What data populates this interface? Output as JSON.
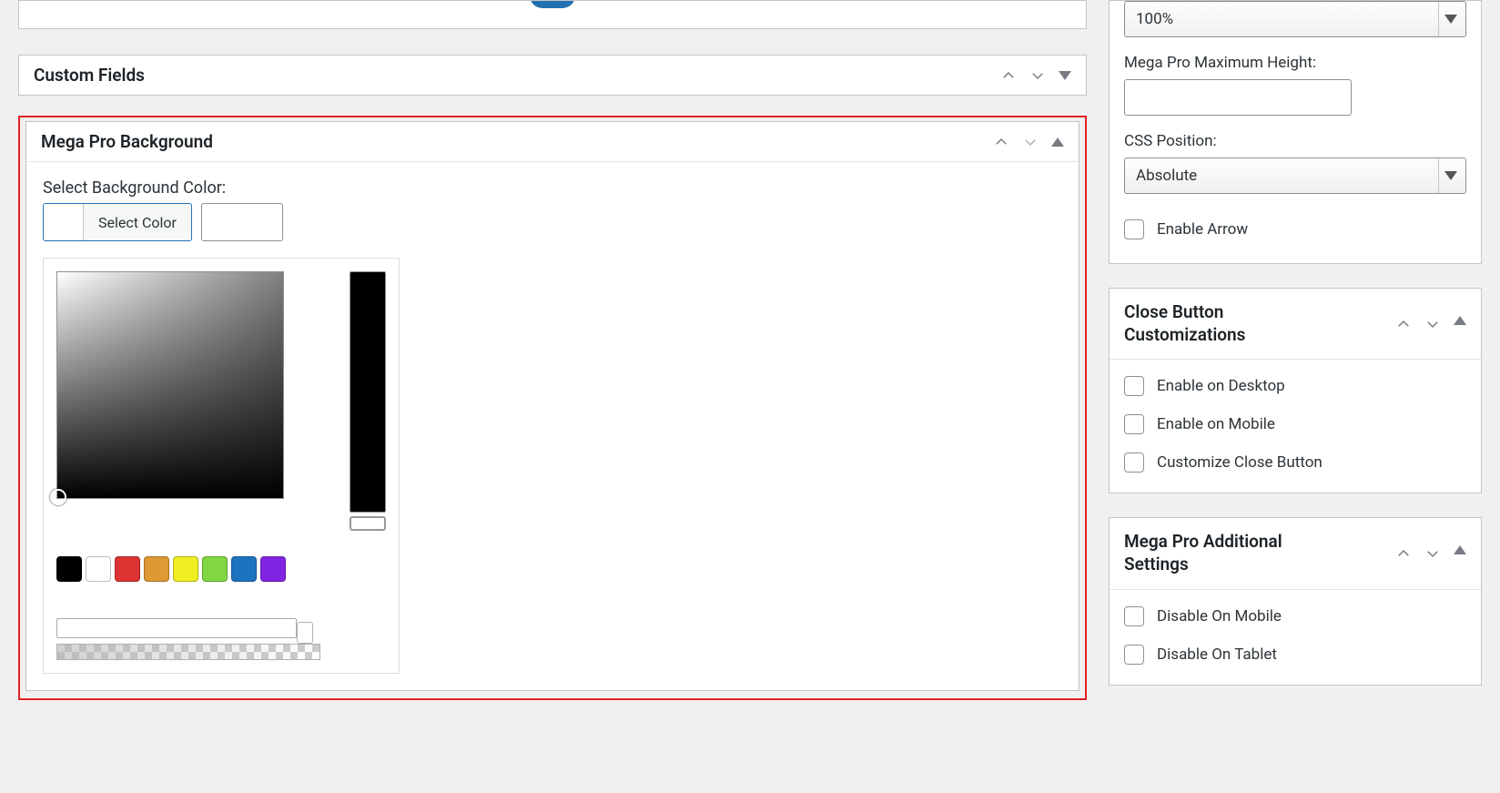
{
  "main": {
    "panels": {
      "custom_fields": {
        "title": "Custom Fields"
      },
      "mega_bg": {
        "title": "Mega Pro Background",
        "bg_label": "Select Background Color:",
        "select_btn": "Select Color"
      }
    }
  },
  "sidebar": {
    "width_select": {
      "value": "100%"
    },
    "max_height": {
      "label": "Mega Pro Maximum Height:",
      "value": ""
    },
    "css_position": {
      "label": "CSS Position:",
      "value": "Absolute"
    },
    "enable_arrow": {
      "label": "Enable Arrow"
    },
    "close_btn_panel": {
      "title": "Close Button Customizations",
      "opts": {
        "desktop": "Enable on Desktop",
        "mobile": "Enable on Mobile",
        "customize": "Customize Close Button"
      }
    },
    "additional_panel": {
      "title": "Mega Pro Additional Settings",
      "opts": {
        "disable_mobile": "Disable On Mobile",
        "disable_tablet": "Disable On Tablet"
      }
    }
  },
  "swatches": [
    "black",
    "white",
    "red",
    "orange",
    "yellow",
    "green",
    "blue",
    "purple"
  ]
}
